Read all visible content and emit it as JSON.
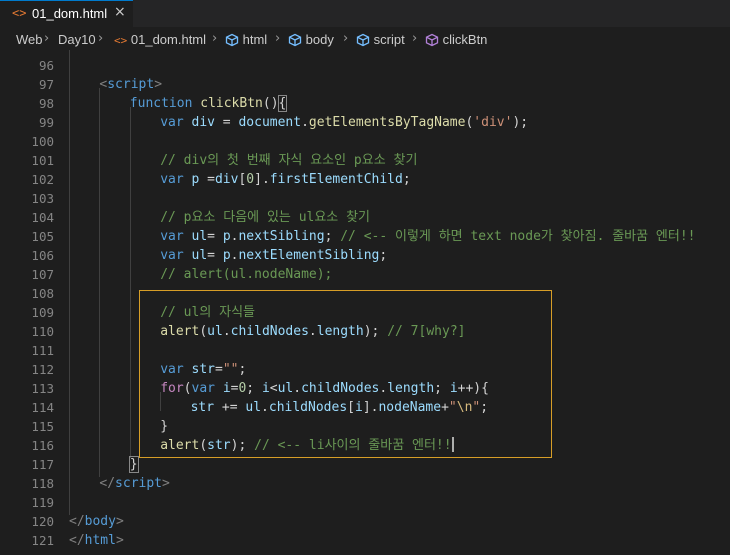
{
  "tab": {
    "icon": "<>",
    "title": "01_dom.html",
    "close": "×"
  },
  "breadcrumb": [
    "Web",
    "Day10",
    "01_dom.html",
    "html",
    "body",
    "script",
    "clickBtn"
  ],
  "lines": [
    {
      "no": "96",
      "indent": 0,
      "tokens": []
    },
    {
      "no": "97",
      "indent": 4,
      "tokens": [
        [
          "t-tag",
          "<"
        ],
        [
          "t-tagname",
          "script"
        ],
        [
          "t-tag",
          ">"
        ]
      ]
    },
    {
      "no": "98",
      "indent": 8,
      "tokens": [
        [
          "t-kw",
          "function"
        ],
        [
          "t-pl",
          " "
        ],
        [
          "t-fn",
          "clickBtn"
        ],
        [
          "t-pl",
          "()"
        ],
        [
          "t-pl",
          "{"
        ]
      ]
    },
    {
      "no": "99",
      "indent": 12,
      "tokens": [
        [
          "t-kw",
          "var"
        ],
        [
          "t-pl",
          " "
        ],
        [
          "t-var",
          "div"
        ],
        [
          "t-pl",
          " = "
        ],
        [
          "t-var",
          "document"
        ],
        [
          "t-pl",
          "."
        ],
        [
          "t-fn",
          "getElementsByTagName"
        ],
        [
          "t-pl",
          "("
        ],
        [
          "t-str",
          "'div'"
        ],
        [
          "t-pl",
          ");"
        ]
      ]
    },
    {
      "no": "100",
      "indent": 0,
      "tokens": []
    },
    {
      "no": "101",
      "indent": 12,
      "tokens": [
        [
          "t-com",
          "// div의 첫 번째 자식 요소인 p요소 찾기"
        ]
      ]
    },
    {
      "no": "102",
      "indent": 12,
      "tokens": [
        [
          "t-kw",
          "var"
        ],
        [
          "t-pl",
          " "
        ],
        [
          "t-var",
          "p"
        ],
        [
          "t-pl",
          " ="
        ],
        [
          "t-var",
          "div"
        ],
        [
          "t-pl",
          "["
        ],
        [
          "t-num",
          "0"
        ],
        [
          "t-pl",
          "]."
        ],
        [
          "t-var",
          "firstElementChild"
        ],
        [
          "t-pl",
          ";"
        ]
      ]
    },
    {
      "no": "103",
      "indent": 0,
      "tokens": []
    },
    {
      "no": "104",
      "indent": 12,
      "tokens": [
        [
          "t-com",
          "// p요소 다음에 있는 ul요소 찾기"
        ]
      ]
    },
    {
      "no": "105",
      "indent": 12,
      "tokens": [
        [
          "t-kw",
          "var"
        ],
        [
          "t-pl",
          " "
        ],
        [
          "t-var",
          "ul"
        ],
        [
          "t-pl",
          "= "
        ],
        [
          "t-var",
          "p"
        ],
        [
          "t-pl",
          "."
        ],
        [
          "t-var",
          "nextSibling"
        ],
        [
          "t-pl",
          "; "
        ],
        [
          "t-com",
          "// <-- 이렇게 하면 text node가 찾아짐. 줄바꿈 엔터!!"
        ]
      ]
    },
    {
      "no": "106",
      "indent": 12,
      "tokens": [
        [
          "t-kw",
          "var"
        ],
        [
          "t-pl",
          " "
        ],
        [
          "t-var",
          "ul"
        ],
        [
          "t-pl",
          "= "
        ],
        [
          "t-var",
          "p"
        ],
        [
          "t-pl",
          "."
        ],
        [
          "t-var",
          "nextElementSibling"
        ],
        [
          "t-pl",
          ";"
        ]
      ]
    },
    {
      "no": "107",
      "indent": 12,
      "tokens": [
        [
          "t-com",
          "// alert(ul.nodeName);"
        ]
      ]
    },
    {
      "no": "108",
      "indent": 0,
      "tokens": []
    },
    {
      "no": "109",
      "indent": 12,
      "tokens": [
        [
          "t-com",
          "// ul의 자식들"
        ]
      ]
    },
    {
      "no": "110",
      "indent": 12,
      "tokens": [
        [
          "t-fn",
          "alert"
        ],
        [
          "t-pl",
          "("
        ],
        [
          "t-var",
          "ul"
        ],
        [
          "t-pl",
          "."
        ],
        [
          "t-var",
          "childNodes"
        ],
        [
          "t-pl",
          "."
        ],
        [
          "t-var",
          "length"
        ],
        [
          "t-pl",
          "); "
        ],
        [
          "t-com",
          "// 7[why?]"
        ]
      ]
    },
    {
      "no": "111",
      "indent": 0,
      "tokens": []
    },
    {
      "no": "112",
      "indent": 12,
      "tokens": [
        [
          "t-kw",
          "var"
        ],
        [
          "t-pl",
          " "
        ],
        [
          "t-var",
          "str"
        ],
        [
          "t-pl",
          "="
        ],
        [
          "t-str",
          "\"\""
        ],
        [
          "t-pl",
          ";"
        ]
      ]
    },
    {
      "no": "113",
      "indent": 12,
      "tokens": [
        [
          "t-ctl",
          "for"
        ],
        [
          "t-pl",
          "("
        ],
        [
          "t-kw",
          "var"
        ],
        [
          "t-pl",
          " "
        ],
        [
          "t-var",
          "i"
        ],
        [
          "t-pl",
          "="
        ],
        [
          "t-num",
          "0"
        ],
        [
          "t-pl",
          "; "
        ],
        [
          "t-var",
          "i"
        ],
        [
          "t-pl",
          "<"
        ],
        [
          "t-var",
          "ul"
        ],
        [
          "t-pl",
          "."
        ],
        [
          "t-var",
          "childNodes"
        ],
        [
          "t-pl",
          "."
        ],
        [
          "t-var",
          "length"
        ],
        [
          "t-pl",
          "; "
        ],
        [
          "t-var",
          "i"
        ],
        [
          "t-pl",
          "++){"
        ]
      ]
    },
    {
      "no": "114",
      "indent": 16,
      "tokens": [
        [
          "t-var",
          "str"
        ],
        [
          "t-pl",
          " += "
        ],
        [
          "t-var",
          "ul"
        ],
        [
          "t-pl",
          "."
        ],
        [
          "t-var",
          "childNodes"
        ],
        [
          "t-pl",
          "["
        ],
        [
          "t-var",
          "i"
        ],
        [
          "t-pl",
          "]."
        ],
        [
          "t-var",
          "nodeName"
        ],
        [
          "t-pl",
          "+"
        ],
        [
          "t-str",
          "\""
        ],
        [
          "t-esc",
          "\\n"
        ],
        [
          "t-str",
          "\""
        ],
        [
          "t-pl",
          ";"
        ]
      ]
    },
    {
      "no": "115",
      "indent": 12,
      "tokens": [
        [
          "t-pl",
          "}"
        ]
      ]
    },
    {
      "no": "116",
      "indent": 12,
      "tokens": [
        [
          "t-fn",
          "alert"
        ],
        [
          "t-pl",
          "("
        ],
        [
          "t-var",
          "str"
        ],
        [
          "t-pl",
          "); "
        ],
        [
          "t-com",
          "// <-- li사이의 줄바꿈 엔터!!"
        ]
      ]
    },
    {
      "no": "117",
      "indent": 8,
      "tokens": [
        [
          "t-pl",
          "}"
        ]
      ]
    },
    {
      "no": "118",
      "indent": 4,
      "tokens": [
        [
          "t-tag",
          "</"
        ],
        [
          "t-tagname",
          "script"
        ],
        [
          "t-tag",
          ">"
        ]
      ]
    },
    {
      "no": "119",
      "indent": 0,
      "tokens": []
    },
    {
      "no": "120",
      "indent": 0,
      "tokens": [
        [
          "t-tag",
          "</"
        ],
        [
          "t-tagname",
          "body"
        ],
        [
          "t-tag",
          ">"
        ]
      ]
    },
    {
      "no": "121",
      "indent": 0,
      "tokens": [
        [
          "t-tag",
          "</"
        ],
        [
          "t-tagname",
          "html"
        ],
        [
          "t-tag",
          ">"
        ]
      ]
    }
  ]
}
